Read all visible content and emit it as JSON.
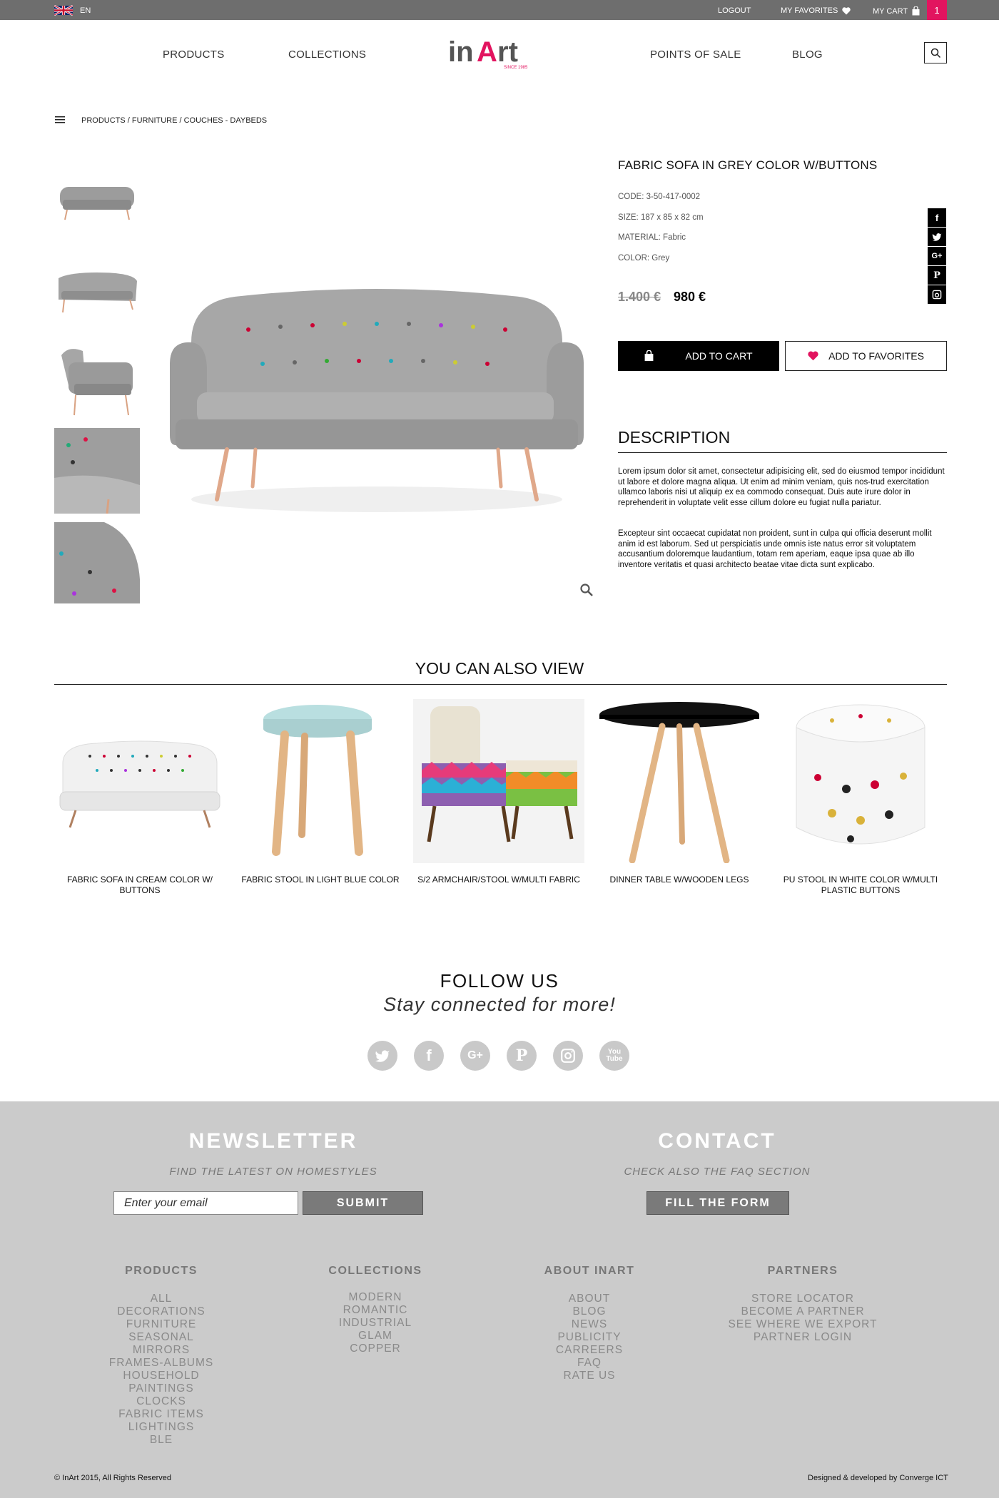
{
  "topbar": {
    "language": "EN",
    "logout": "LOGOUT",
    "favorites": "MY FAVORITES",
    "cart": "MY CART",
    "cart_count": "1"
  },
  "nav": {
    "products": "PRODUCTS",
    "collections": "COLLECTIONS",
    "points_of_sale": "POINTS OF SALE",
    "blog": "BLOG"
  },
  "logo": {
    "name": "inArt",
    "tagline": "SINCE 1985"
  },
  "breadcrumb": "PRODUCTS / FURNITURE / COUCHES - DAYBEDS",
  "product": {
    "title": "FABRIC SOFA IN GREY COLOR W/BUTTONS",
    "code": "CODE: 3-50-417-0002",
    "size": "SIZE: 187 x 85 x 82 cm",
    "material": "MATERIAL: Fabric",
    "color": "COLOR: Grey",
    "old_price": "1.400 €",
    "price": "980 €",
    "add_to_cart": "ADD TO CART",
    "add_to_favorites": "ADD TO FAVORITES"
  },
  "description": {
    "title": "DESCRIPTION",
    "p1": "Lorem ipsum dolor sit amet, consectetur adipisicing elit, sed do eiusmod tempor incididunt ut labore et dolore magna aliqua. Ut enim ad minim veniam, quis nos-trud exercitation ullamco laboris nisi ut aliquip ex ea commodo consequat. Duis aute irure dolor in reprehenderit in voluptate velit esse cillum dolore eu fugiat nulla pariatur.",
    "p2": "Excepteur sint occaecat cupidatat non proident, sunt in culpa qui officia deserunt mollit anim id est laborum. Sed ut perspiciatis unde omnis iste natus error sit voluptatem accusantium doloremque laudantium, totam rem aperiam, eaque ipsa quae ab illo inventore veritatis et quasi architecto beatae vitae dicta sunt explicabo."
  },
  "share_icons": [
    "facebook-icon",
    "twitter-icon",
    "google-plus-icon",
    "pinterest-icon",
    "instagram-icon"
  ],
  "related": {
    "title": "YOU CAN ALSO VIEW",
    "items": [
      {
        "label": "FABRIC SOFA IN CREAM COLOR W/ BUTTONS"
      },
      {
        "label": "FABRIC STOOL IN LIGHT BLUE COLOR"
      },
      {
        "label": "S/2 ARMCHAIR/STOOL W/MULTI FABRIC"
      },
      {
        "label": "DINNER TABLE W/WOODEN LEGS"
      },
      {
        "label": "PU STOOL IN WHITE COLOR W/MULTI PLASTIC BUTTONS"
      }
    ]
  },
  "follow": {
    "title": "FOLLOW US",
    "subtitle": "Stay connected for more!",
    "icons": [
      "twitter-icon",
      "facebook-icon",
      "google-plus-icon",
      "pinterest-icon",
      "instagram-icon",
      "youtube-icon"
    ]
  },
  "footer": {
    "newsletter_title": "NEWSLETTER",
    "newsletter_sub": "FIND THE LATEST ON HOMESTYLES",
    "email_placeholder": "Enter your email",
    "submit": "SUBMIT",
    "contact_title": "CONTACT",
    "contact_sub": "CHECK  ALSO THE FAQ SECTION",
    "fill_form": "FILL  THE FORM",
    "columns": [
      {
        "heading": "PRODUCTS",
        "items": [
          "ALL",
          "DECORATIONS",
          "FURNITURE",
          "SEASONAL",
          "MIRRORS",
          "FRAMES-ALBUMS",
          "HOUSEHOLD",
          "PAINTINGS",
          "CLOCKS",
          "FABRIC ITEMS",
          "LIGHTINGS",
          "BLE"
        ]
      },
      {
        "heading": "COLLECTIONS",
        "items": [
          "MODERN",
          "ROMANTIC",
          "INDUSTRIAL",
          "GLAM",
          "COPPER"
        ]
      },
      {
        "heading": "ABOUT INART",
        "items": [
          "ABOUT",
          "BLOG",
          "NEWS",
          "PUBLICITY",
          "CARREERS",
          "FAQ",
          "RATE US"
        ]
      },
      {
        "heading": "PARTNERS",
        "items": [
          "STORE LOCATOR",
          "BECOME A PARTNER",
          "SEE WHERE WE EXPORT",
          "PARTNER LOGIN"
        ]
      }
    ],
    "copyright": "© InArt 2015, All Rights Reserved",
    "credit": "Designed & developed by Converge ICT"
  },
  "colors": {
    "accent": "#e2145f",
    "topbar": "#6e6e6e",
    "footer": "#cbcbcb"
  }
}
